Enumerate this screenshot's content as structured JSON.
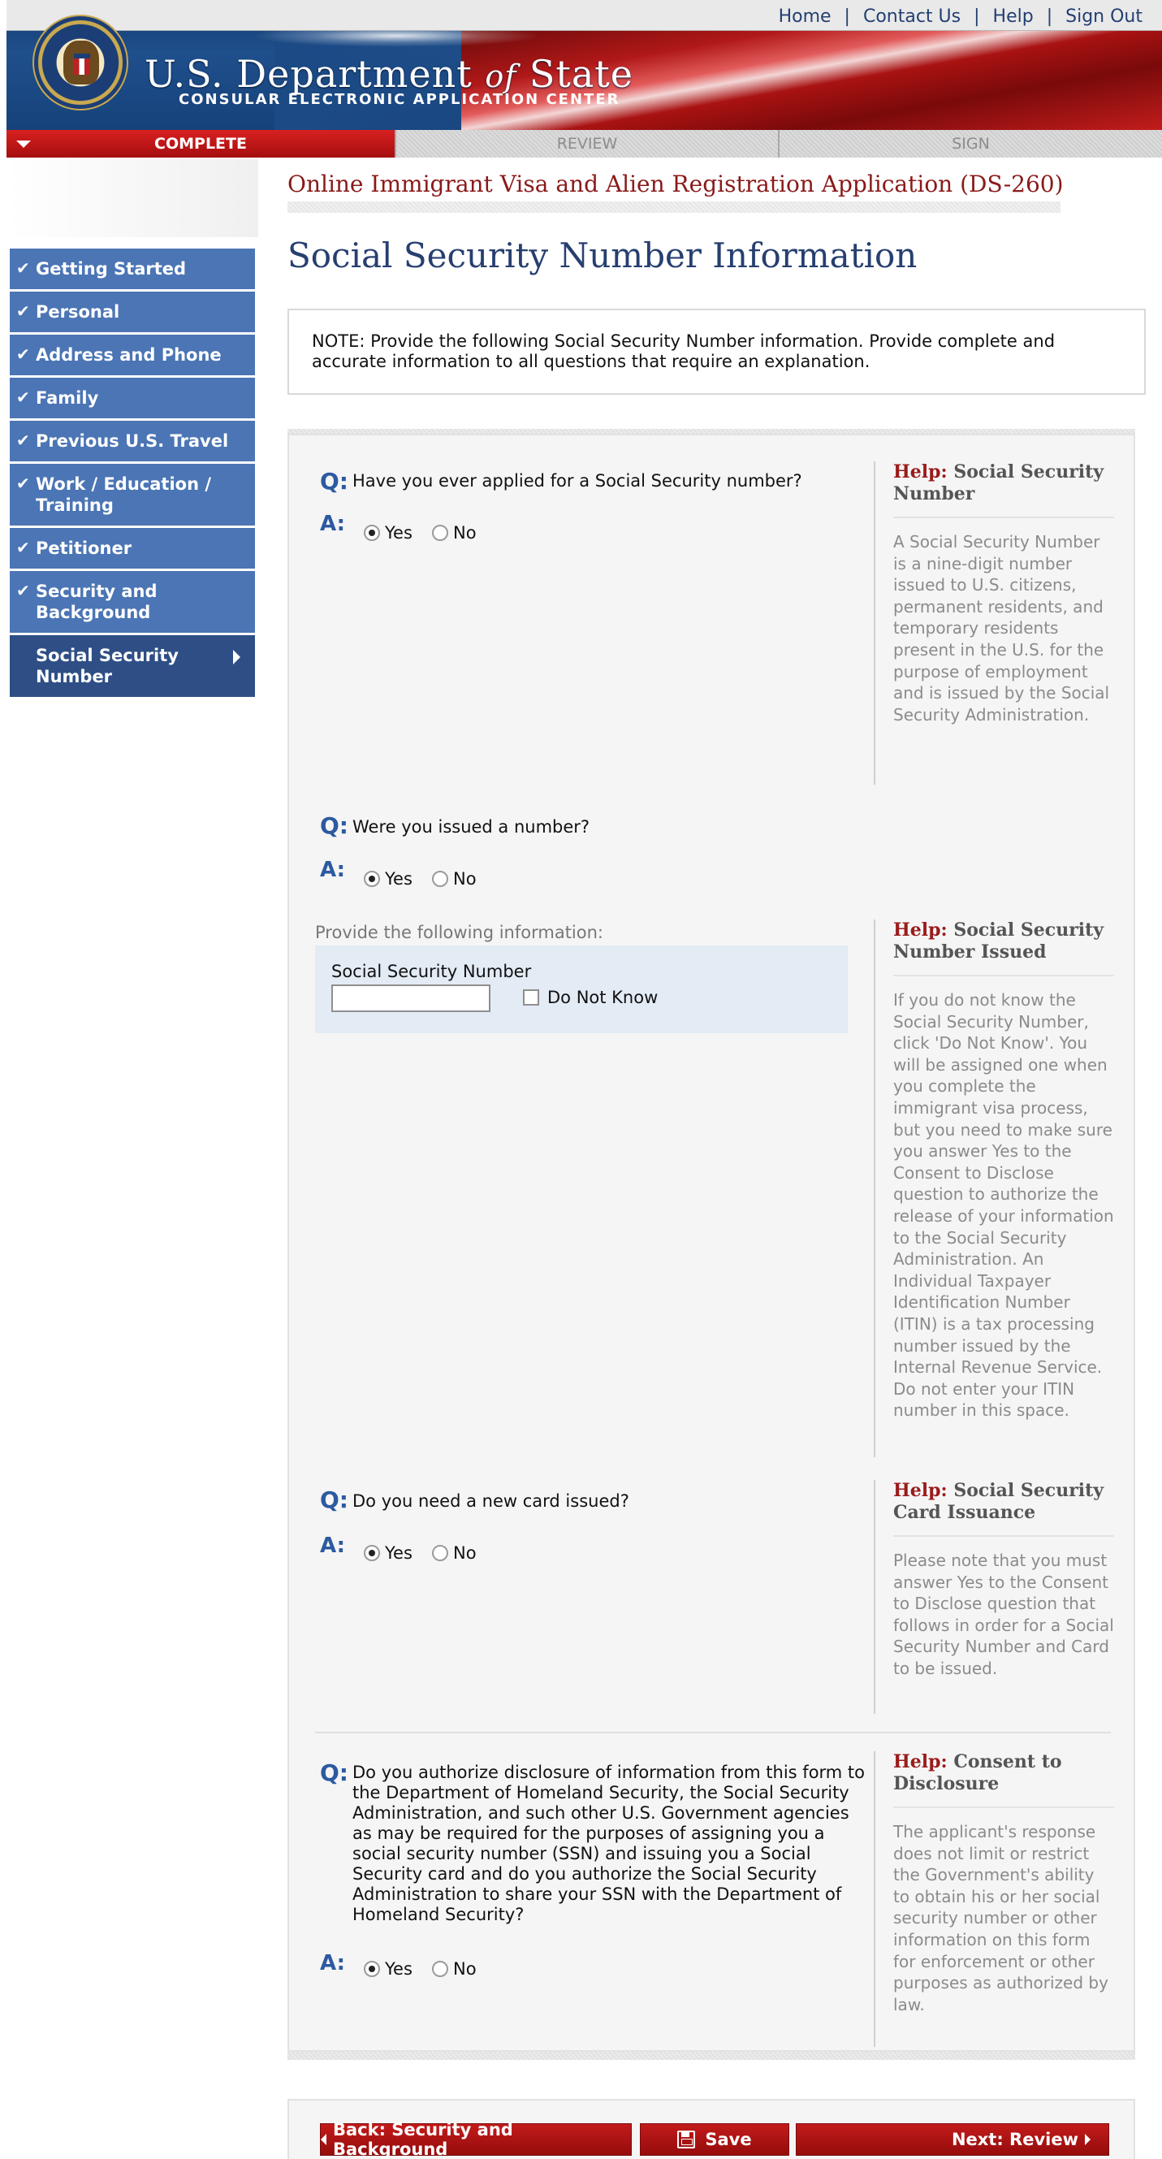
{
  "header": {
    "nav_links": [
      "Home",
      "Contact Us",
      "Help",
      "Sign Out"
    ],
    "title_part1": "U.S. Department ",
    "title_of": "of",
    "title_part2": " State",
    "subtitle": "CONSULAR ELECTRONIC APPLICATION CENTER"
  },
  "progress": {
    "complete": "COMPLETE",
    "review": "REVIEW",
    "sign": "SIGN"
  },
  "sidebar": {
    "check": "✔",
    "items": [
      {
        "label": "Getting Started"
      },
      {
        "label": "Personal"
      },
      {
        "label": "Address and Phone"
      },
      {
        "label": "Family"
      },
      {
        "label": "Previous U.S. Travel"
      },
      {
        "label": "Work / Education / Training"
      },
      {
        "label": "Petitioner"
      },
      {
        "label": "Security and Background"
      },
      {
        "label": "Social Security Number"
      }
    ]
  },
  "main": {
    "app_name": "Online Immigrant Visa and Alien Registration Application (DS-260)",
    "page_title": "Social Security Number Information",
    "note": "NOTE: Provide the following Social Security Number information. Provide complete and accurate information to all questions that require an explanation."
  },
  "labels": {
    "q": "Q:",
    "a": "A:",
    "yes": "Yes",
    "no": "No"
  },
  "questions": [
    {
      "text": "Have you ever applied for a Social Security number?",
      "answer": "Yes"
    },
    {
      "text": "Were you issued a number?",
      "answer": "Yes"
    },
    {
      "text": "Do you need a new card issued?",
      "answer": "Yes"
    },
    {
      "text": "Do you authorize disclosure of information from this form to the Department of Homeland Security, the Social Security Administration, and such other U.S. Government agencies as may be required for the purposes of assigning you a social security number (SSN) and issuing you a Social Security card and do you authorize the Social Security Administration to share your SSN with the Department of Homeland Security?",
      "answer": "Yes"
    }
  ],
  "ssn": {
    "provide_label": "Provide the following information:",
    "field_label": "Social Security Number",
    "value": "",
    "do_not_know": "Do Not Know"
  },
  "help": {
    "prefix": "Help:",
    "items": [
      {
        "title": "Social Security Number",
        "body": "A Social Security Number is a nine-digit number issued to U.S. citizens, permanent residents, and temporary residents present in the U.S. for the purpose of employment and is issued by the Social Security Administration."
      },
      {
        "title": "Social Security Number Issued",
        "body": "If you do not know the Social Security Number, click 'Do Not Know'. You will be assigned one when you complete the immigrant visa process, but you need to make sure you answer Yes to the Consent to Disclose question to authorize the release of your information to the Social Security Administration. An Individual Taxpayer Identification Number (ITIN) is a tax processing number issued by the Internal Revenue Service. Do not enter your ITIN number in this space."
      },
      {
        "title": "Social Security Card Issuance",
        "body": "Please note that you must answer Yes to the Consent to Disclose question that follows in order for a Social Security Number and Card to be issued."
      },
      {
        "title": "Consent to Disclosure",
        "body": "The applicant's response does not limit or restrict the Government's ability to obtain his or her social security number or other information on this form for enforcement or other purposes as authorized by law."
      }
    ]
  },
  "buttons": {
    "back": "Back: Security and Background",
    "save": "Save",
    "next": "Next: Review"
  },
  "colors": {
    "brand_red": "#b01818",
    "nav_blue": "#4b75b4",
    "nav_current": "#2e4e85",
    "q_blue": "#2c5aa0"
  }
}
